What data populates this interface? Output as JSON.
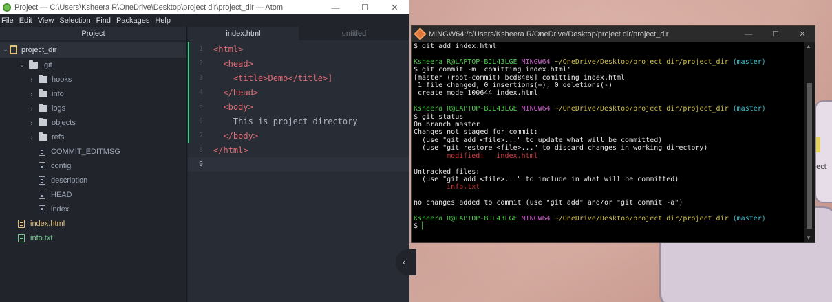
{
  "atom": {
    "title": "Project — C:\\Users\\Ksheera R\\OneDrive\\Desktop\\project dir\\project_dir — Atom",
    "window_controls": [
      "—",
      "☐",
      "✕"
    ],
    "menu": [
      "File",
      "Edit",
      "View",
      "Selection",
      "Find",
      "Packages",
      "Help"
    ],
    "tree": {
      "header": "Project",
      "items": [
        {
          "label": "project_dir",
          "type": "root"
        },
        {
          "label": ".git",
          "type": "folder-open"
        },
        {
          "label": "hooks",
          "type": "folder"
        },
        {
          "label": "info",
          "type": "folder"
        },
        {
          "label": "logs",
          "type": "folder"
        },
        {
          "label": "objects",
          "type": "folder"
        },
        {
          "label": "refs",
          "type": "folder"
        },
        {
          "label": "COMMIT_EDITMSG",
          "type": "file"
        },
        {
          "label": "config",
          "type": "file"
        },
        {
          "label": "description",
          "type": "file"
        },
        {
          "label": "HEAD",
          "type": "file"
        },
        {
          "label": "index",
          "type": "file"
        },
        {
          "label": "index.html",
          "type": "file-modified"
        },
        {
          "label": "info.txt",
          "type": "file-new"
        }
      ]
    },
    "tabs": [
      "index.html",
      "untitled"
    ],
    "line_numbers": [
      "1",
      "2",
      "3",
      "4",
      "5",
      "6",
      "7",
      "8",
      "9"
    ],
    "code": [
      "<html>",
      "  <head>",
      "    <title>Demo</title>]",
      "  </head>",
      "  <body>",
      "    This is project directory",
      "  </body>",
      "</html>",
      ""
    ],
    "collapse_glyph": "‹"
  },
  "terminal": {
    "title": "MINGW64:/c/Users/Ksheera R/OneDrive/Desktop/project dir/project_dir",
    "controls": [
      "—",
      "☐",
      "✕"
    ],
    "user": "Ksheera R@LAPTOP-BJL43LGE",
    "shell": "MINGW64",
    "path": "~/OneDrive/Desktop/project dir/project_dir",
    "branch": "(master)",
    "lines": {
      "l1": "$ git add index.html",
      "l3": "$ git commit -m 'comitting index.html'",
      "l4": "[master (root-commit) bcd84e0] comitting index.html",
      "l5": " 1 file changed, 0 insertions(+), 0 deletions(-)",
      "l6": " create mode 100644 index.html",
      "l8": "$ git status",
      "l9": "On branch master",
      "l10": "Changes not staged for commit:",
      "l11": "  (use \"git add <file>...\" to update what will be committed)",
      "l12": "  (use \"git restore <file>...\" to discard changes in working directory)",
      "l13": "        modified:   index.html",
      "l15": "Untracked files:",
      "l16": "  (use \"git add <file>...\" to include in what will be committed)",
      "l17": "        info.txt",
      "l19": "no changes added to commit (use \"git add\" and/or \"git commit -a\")",
      "prompt": "$ "
    }
  },
  "desktop": {
    "label": "ect"
  },
  "colors": {
    "git_user": "#4ec94e",
    "git_shell": "#c45ec4",
    "git_path": "#d0c04a",
    "git_branch": "#3fc5d0",
    "modified": "#d03a3a"
  }
}
